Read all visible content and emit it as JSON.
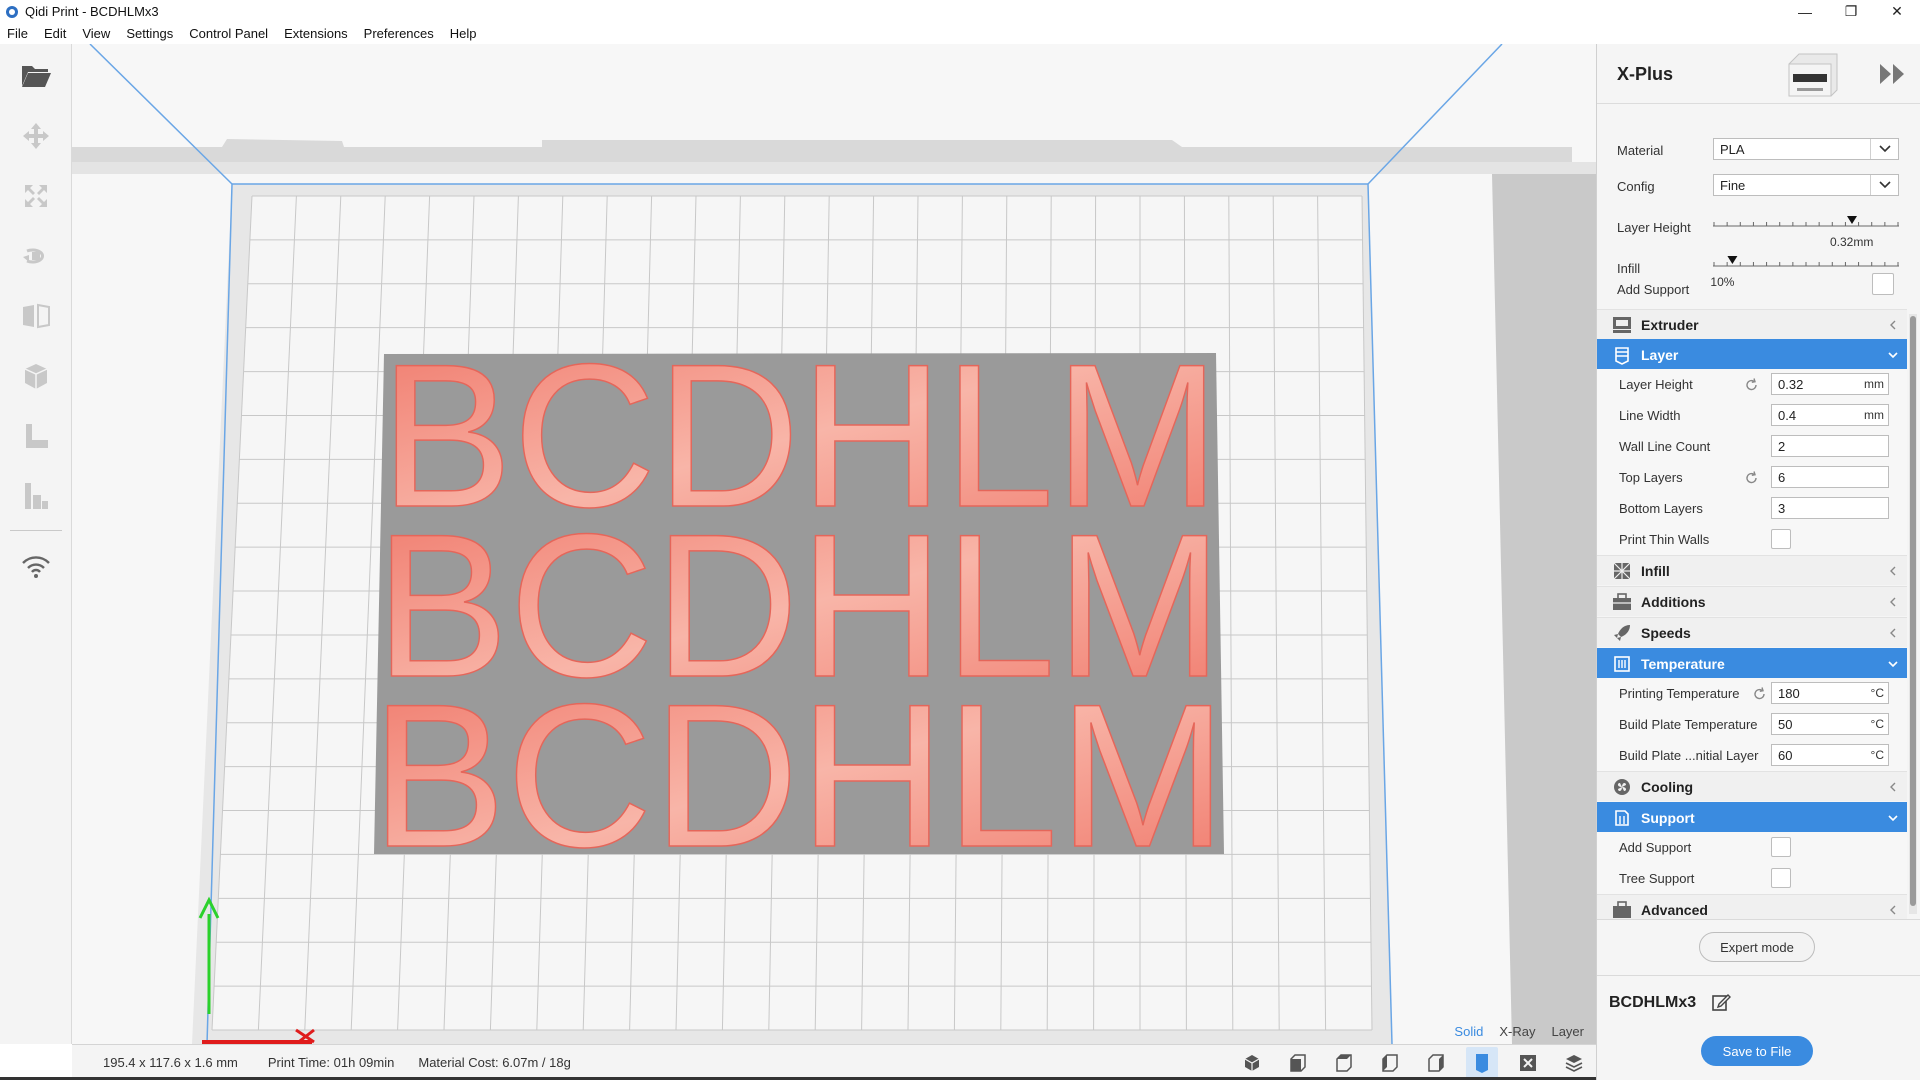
{
  "window": {
    "title": "Qidi Print - BCDHLMx3",
    "minimize": "—",
    "maximize": "❐",
    "close": "✕"
  },
  "menu": [
    "File",
    "Edit",
    "View",
    "Settings",
    "Control Panel",
    "Extensions",
    "Preferences",
    "Help"
  ],
  "toolbar": [
    "open-icon",
    "move-icon",
    "scale-icon",
    "rotate-icon",
    "mirror-icon",
    "per-model-settings-icon",
    "support-blocker-icon",
    "lay-flat-icon",
    "wifi-icon"
  ],
  "viewport": {
    "model_text": "BCDHLM",
    "model_rows": 3,
    "model_color": "#f0786a",
    "plate_color": "#9a9a9a",
    "axis_y_label": "Y",
    "view_modes": [
      "Solid",
      "X-Ray",
      "Layer"
    ],
    "active_view_mode": "Solid",
    "accent": "#3a8be0"
  },
  "status": {
    "dimensions": "195.4 x 117.6 x 1.6 mm",
    "print_time_label": "Print Time:",
    "print_time": "01h 09min",
    "material_cost_label": "Material Cost:",
    "material_cost": "6.07m / 18g"
  },
  "panel": {
    "printer": "X-Plus",
    "material_label": "Material",
    "material_value": "PLA",
    "config_label": "Config",
    "config_value": "Fine",
    "layer_height_label": "Layer Height",
    "layer_height_value": "0.32mm",
    "layer_height_fraction": 0.75,
    "infill_label": "Infill",
    "infill_value": "10%",
    "infill_fraction": 0.1,
    "add_support_label": "Add Support",
    "categories": {
      "extruder": "Extruder",
      "layer": "Layer",
      "infill": "Infill",
      "additions": "Additions",
      "speeds": "Speeds",
      "temperature": "Temperature",
      "cooling": "Cooling",
      "support": "Support",
      "advanced": "Advanced"
    },
    "layer_settings": {
      "layer_height": {
        "label": "Layer Height",
        "value": "0.32",
        "unit": "mm"
      },
      "line_width": {
        "label": "Line Width",
        "value": "0.4",
        "unit": "mm"
      },
      "wall_line_count": {
        "label": "Wall Line Count",
        "value": "2"
      },
      "top_layers": {
        "label": "Top Layers",
        "value": "6"
      },
      "bottom_layers": {
        "label": "Bottom Layers",
        "value": "3"
      },
      "print_thin_walls": {
        "label": "Print Thin Walls"
      }
    },
    "temperature_settings": {
      "printing_temp": {
        "label": "Printing Temperature",
        "value": "180",
        "unit": "°C"
      },
      "build_plate_temp": {
        "label": "Build Plate Temperature",
        "value": "50",
        "unit": "°C"
      },
      "build_plate_initial": {
        "label": "Build Plate ...nitial Layer",
        "value": "60",
        "unit": "°C"
      }
    },
    "support_settings": {
      "add_support": {
        "label": "Add Support"
      },
      "tree_support": {
        "label": "Tree Support"
      }
    },
    "expert_mode": "Expert mode",
    "job_name": "BCDHLMx3",
    "save_button": "Save to File"
  }
}
